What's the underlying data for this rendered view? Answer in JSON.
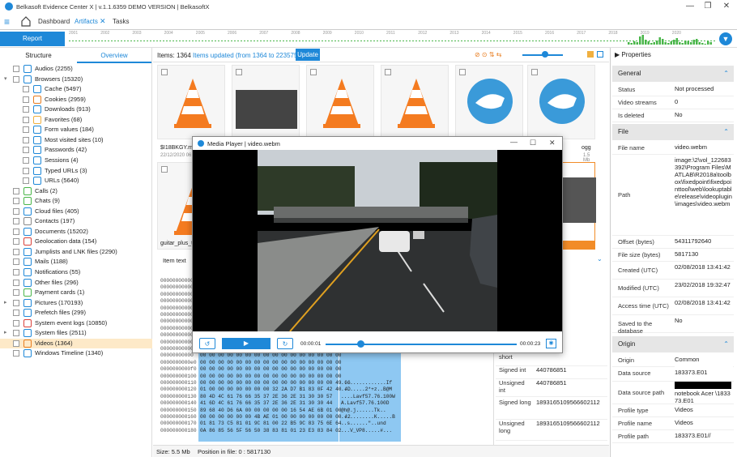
{
  "window": {
    "title": "Belkasoft Evidence Center X | v.1.1.6359 DEMO VERSION | BelkasoftX"
  },
  "nav": {
    "dashboard": "Dashboard",
    "artifacts": "Artifacts",
    "tasks": "Tasks"
  },
  "report_label": "Report",
  "timeline_years": [
    "2001",
    "2002",
    "2003",
    "2004",
    "2005",
    "2006",
    "2007",
    "2008",
    "2009",
    "2010",
    "2011",
    "2012",
    "2013",
    "2014",
    "2015",
    "2016",
    "2017",
    "2018",
    "2019",
    "2020"
  ],
  "left_tabs": {
    "structure": "Structure",
    "overview": "Overview"
  },
  "tree": [
    {
      "label": "Audios (2255)",
      "indent": 0,
      "arrow": ""
    },
    {
      "label": "Browsers (15320)",
      "indent": 0,
      "arrow": "▾"
    },
    {
      "label": "Cache (5497)",
      "indent": 1,
      "arrow": ""
    },
    {
      "label": "Cookies (2959)",
      "indent": 1,
      "arrow": ""
    },
    {
      "label": "Downloads (913)",
      "indent": 1,
      "arrow": ""
    },
    {
      "label": "Favorites (68)",
      "indent": 1,
      "arrow": ""
    },
    {
      "label": "Form values (184)",
      "indent": 1,
      "arrow": ""
    },
    {
      "label": "Most visited sites (10)",
      "indent": 1,
      "arrow": ""
    },
    {
      "label": "Passwords (42)",
      "indent": 1,
      "arrow": ""
    },
    {
      "label": "Sessions (4)",
      "indent": 1,
      "arrow": ""
    },
    {
      "label": "Typed URLs (3)",
      "indent": 1,
      "arrow": ""
    },
    {
      "label": "URLs (5640)",
      "indent": 1,
      "arrow": ""
    },
    {
      "label": "Calls (2)",
      "indent": 0,
      "arrow": ""
    },
    {
      "label": "Chats (9)",
      "indent": 0,
      "arrow": ""
    },
    {
      "label": "Cloud files (405)",
      "indent": 0,
      "arrow": ""
    },
    {
      "label": "Contacts (197)",
      "indent": 0,
      "arrow": ""
    },
    {
      "label": "Documents (15202)",
      "indent": 0,
      "arrow": ""
    },
    {
      "label": "Geolocation data (154)",
      "indent": 0,
      "arrow": ""
    },
    {
      "label": "Jumplists and LNK files (2290)",
      "indent": 0,
      "arrow": ""
    },
    {
      "label": "Mails (1188)",
      "indent": 0,
      "arrow": ""
    },
    {
      "label": "Notifications (55)",
      "indent": 0,
      "arrow": ""
    },
    {
      "label": "Other files (296)",
      "indent": 0,
      "arrow": ""
    },
    {
      "label": "Payment cards (1)",
      "indent": 0,
      "arrow": ""
    },
    {
      "label": "Pictures (170193)",
      "indent": 0,
      "arrow": "▸"
    },
    {
      "label": "Prefetch files (299)",
      "indent": 0,
      "arrow": ""
    },
    {
      "label": "System event logs (10850)",
      "indent": 0,
      "arrow": ""
    },
    {
      "label": "System files (2511)",
      "indent": 0,
      "arrow": "▸"
    },
    {
      "label": "Videos (1364)",
      "indent": 0,
      "arrow": "",
      "selected": true
    },
    {
      "label": "Windows Timeline (1340)",
      "indent": 0,
      "arrow": ""
    }
  ],
  "items_bar": {
    "count": "Items: 1364",
    "updated": "Items updated (from 1364 to 223575)",
    "update_btn": "Update"
  },
  "thumbs": {
    "t1": "$I18BKGY.mk",
    "t1date": "22/12/2020 06:",
    "t6": "ogg",
    "t6size": "1.5 Mb",
    "t7": "guitar_plus_t"
  },
  "item_text_label": "Item text",
  "hex_offsets": [
    "00000000000",
    "00000000000",
    "00000000000",
    "00000000000",
    "00000000000",
    "00000000000",
    "00000000000",
    "00000000000",
    "00000000000",
    "00000000000",
    "00000000000",
    "00000000000",
    "0000000000e0",
    "0000000000f0",
    "000000000100",
    "000000000110",
    "000000000120",
    "000000000130",
    "000000000140",
    "000000000150",
    "000000000160",
    "000000000170",
    "000000000180"
  ],
  "hex_bytes": [
    "00 00 00 00 00 00 00 00 00 00 00 00 00 00 00 00",
    "00 00 00 00 00 00 00 00 00 00 00 00 00 00 00 00",
    "00 00 00 00 00 00 00 00 00 00 00 00 00 00 00 00",
    "00 00 00 00 00 00 00 00 00 00 00 00 00 00 00 00",
    "00 00 00 00 00 00 00 00 00 00 00 00 00 00 00 00",
    "00 00 00 00 00 00 00 00 00 00 00 00 00 00 00 00",
    "00 00 00 00 00 00 00 00 00 00 00 00 00 00 00 00",
    "00 00 00 00 00 00 00 00 00 00 00 00 00 00 00 00",
    "00 00 00 00 00 00 00 00 00 00 00 00 00 00 00 00",
    "00 00 00 00 00 00 00 00 00 00 00 00 00 00 00 00",
    "00 00 00 00 00 00 00 00 00 00 00 00 00 00 00 00",
    "00 00 00 00 00 00 00 00 00 00 00 00 00 00 00 00",
    "00 00 00 00 00 00 00 00 00 00 00 00 00 00 00 00",
    "00 00 00 00 00 00 00 00 00 00 00 00 00 00 00 00",
    "00 00 00 00 00 00 00 00 00 00 00 00 00 00 00 00",
    "00 00 00 00 00 00 00 00 00 00 00 00 00 00 00 49 66",
    "01 00 00 00 00 00 00 00 32 2A D7 B1 83 0F 42 40 4D",
    "80 4D 4C 61 76 66 35 37 2E 36 2E 31 30 30 57",
    "41 6D 4C 61 76 66 35 37 2E 36 2E 31 30 30 44",
    "89 68 40 D6 6A 00 00 00 00 00 16 54 AE 6B 01 00",
    "00 00 00 00 00 00 4B AE 01 00 00 00 00 00 00 00 42",
    "01 81 73 C5 81 01 9C 81 00 22 B5 9C 83 75 6E 64",
    "0A 86 85 56 5F 56 50 38 83 81 01 23 E3 83 84 02"
  ],
  "hex_ascii": [
    "",
    "",
    "",
    "",
    "",
    "",
    "",
    "",
    "",
    "",
    "",
    "",
    "",
    "",
    "",
    "...............If",
    "........2*+z..B@M",
    "....Lavf57.76.100W",
    "A.Lavf57.76.100D",
    "@h@.j......Tk..",
    "...........K.....B",
    "..s......\"..und",
    "...V_VP8.....#..."
  ],
  "interp": [
    {
      "k": "short",
      "v": ""
    },
    {
      "k": "Signed int",
      "v": "440786851"
    },
    {
      "k": "Unsigned int",
      "v": "440786851"
    },
    {
      "k": "Signed long",
      "v": "1893165109566602112"
    },
    {
      "k": "Unsigned long",
      "v": "1893165109566602112"
    }
  ],
  "status": {
    "size": "Size: 5.5 Mb",
    "position": "Position in file: 0 : 5817130"
  },
  "player": {
    "title": "Media Player | video.webm",
    "current": "00:00:01",
    "total": "00:00:23",
    "progress": 0.05
  },
  "props": {
    "header": "Properties",
    "general_title": "General",
    "general": [
      {
        "k": "Status",
        "v": "Not processed"
      },
      {
        "k": "Video streams",
        "v": "0"
      },
      {
        "k": "Is deleted",
        "v": "No"
      }
    ],
    "file_title": "File",
    "file": [
      {
        "k": "File name",
        "v": "video.webm"
      },
      {
        "k": "Path",
        "v": "image:\\2\\vol_122683392\\Program Files\\MATLAB\\R2018a\\toolbox\\fixedpoint\\fixedpointtool\\web\\lookuptable\\release\\videoplugin\\images\\video.webm"
      },
      {
        "k": "Offset (bytes)",
        "v": "54311792640"
      },
      {
        "k": "File size (bytes)",
        "v": "5817130"
      },
      {
        "k": "Created (UTC)",
        "v": "02/08/2018 13:41:42"
      },
      {
        "k": "Modified (UTC)",
        "v": "23/02/2018 19:32:47"
      },
      {
        "k": "Access time (UTC)",
        "v": "02/08/2018 13:41:42"
      },
      {
        "k": "Saved to the database",
        "v": "No"
      }
    ],
    "origin_title": "Origin",
    "origin": [
      {
        "k": "Origin",
        "v": "Common"
      },
      {
        "k": "Data source",
        "v": "183373.E01"
      },
      {
        "k": "Data source path",
        "v": "notebook Acer \\183373.E01"
      },
      {
        "k": "Profile type",
        "v": "Videos"
      },
      {
        "k": "Profile name",
        "v": "Videos"
      },
      {
        "k": "Profile path",
        "v": "183373.E01//"
      }
    ]
  },
  "colors": {
    "accent": "#1e88d8",
    "selection": "#fde9c8",
    "hex_highlight": "#8ec8f2"
  }
}
